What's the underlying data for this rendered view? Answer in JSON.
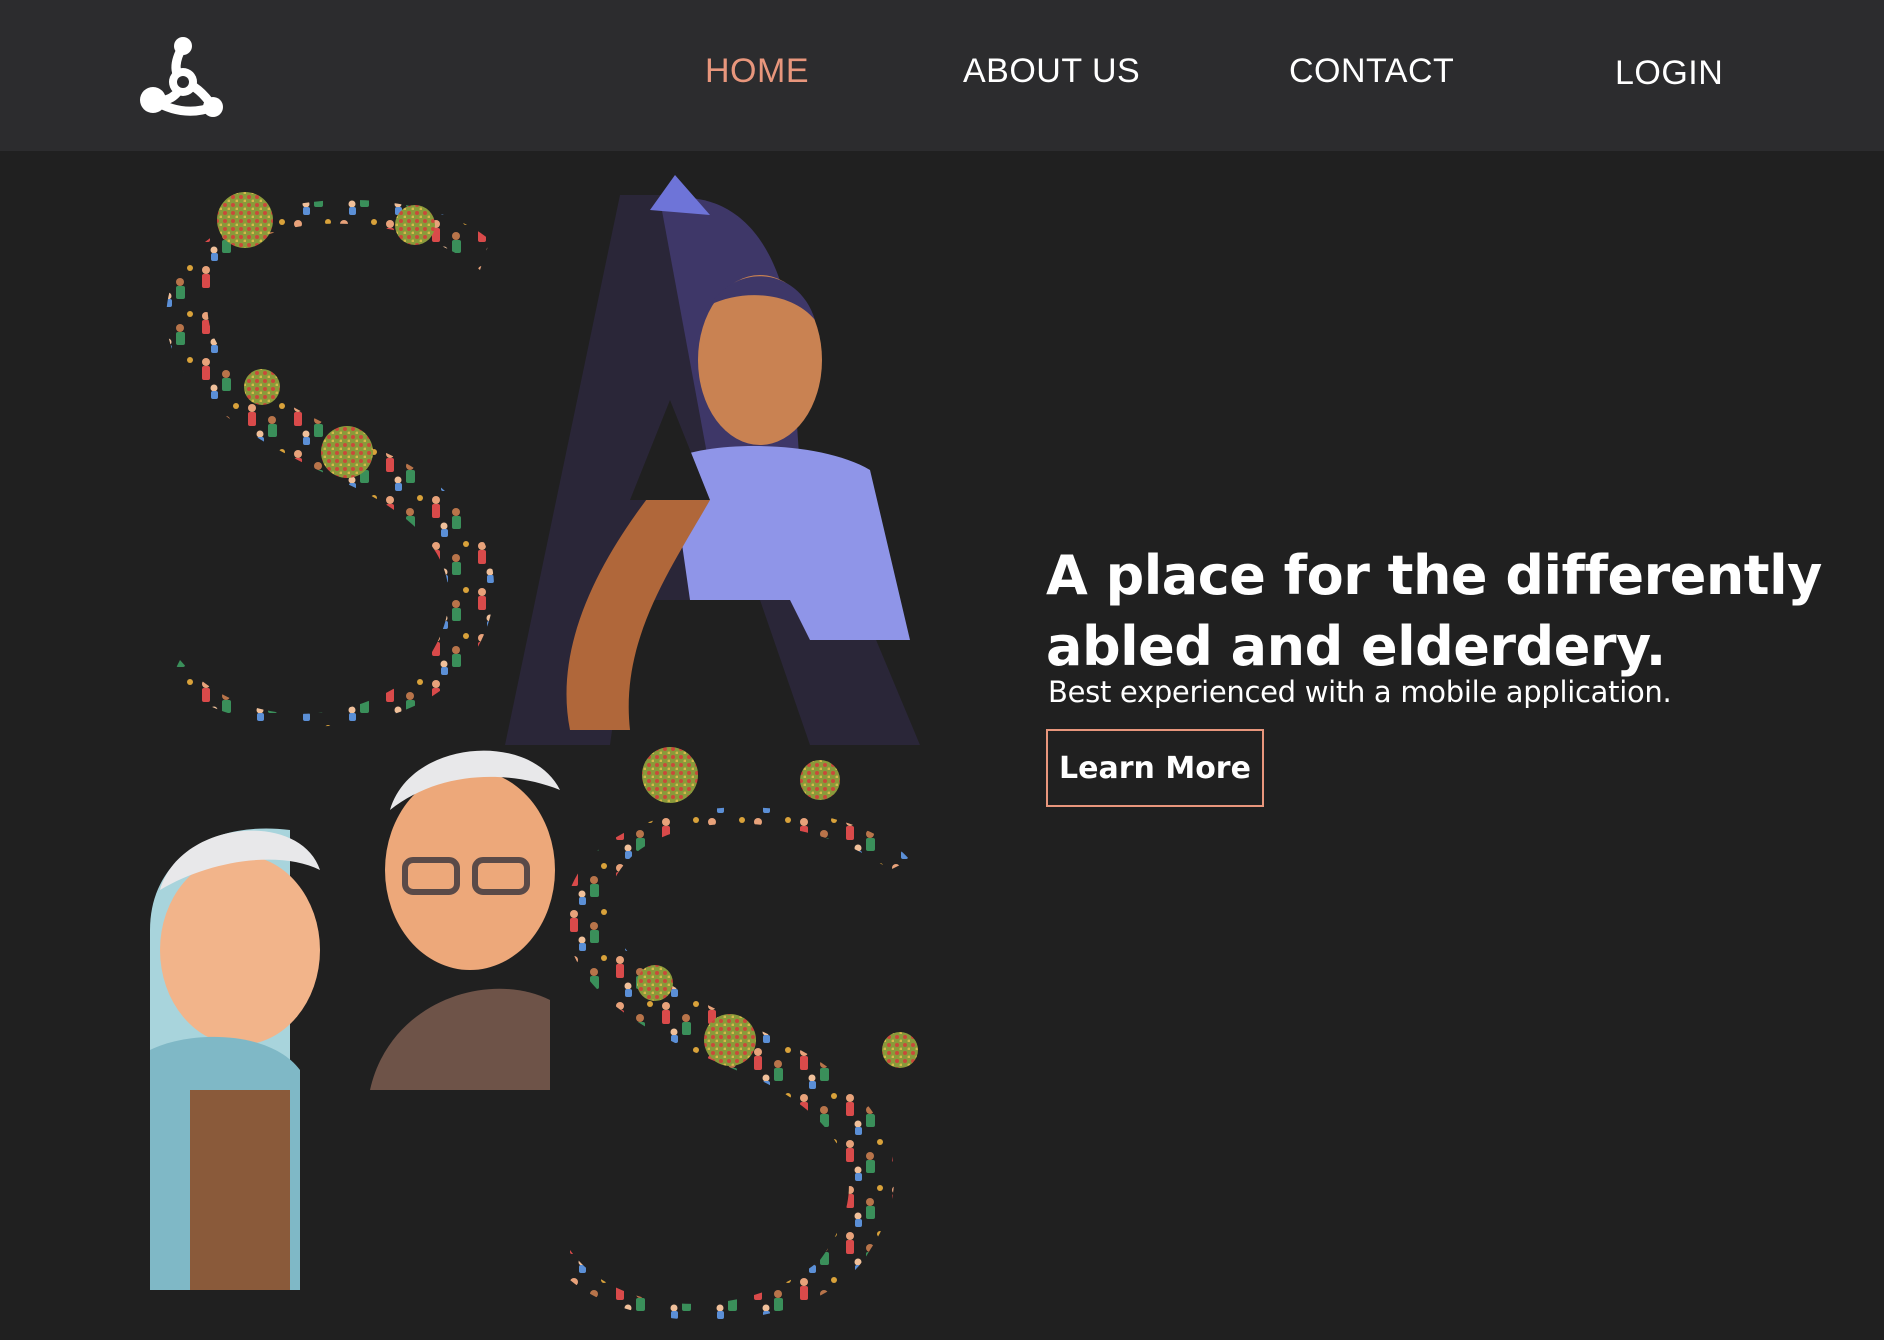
{
  "nav": {
    "logo_icon": "network-triangle-logo",
    "items": [
      {
        "label": "HOME",
        "active": true
      },
      {
        "label": "ABOUT US",
        "active": false
      },
      {
        "label": "CONTACT",
        "active": false
      },
      {
        "label": "LOGIN",
        "active": false
      }
    ],
    "active_color": "#e8967c"
  },
  "hero": {
    "title": "A place for the differently abled and elderdery.",
    "subtitle": "Best experienced with a mobile application.",
    "button_label": "Learn More",
    "art_letters": "SA S",
    "colors": {
      "background": "#202020",
      "header": "#2c2c2e",
      "accent": "#e8967c"
    }
  }
}
